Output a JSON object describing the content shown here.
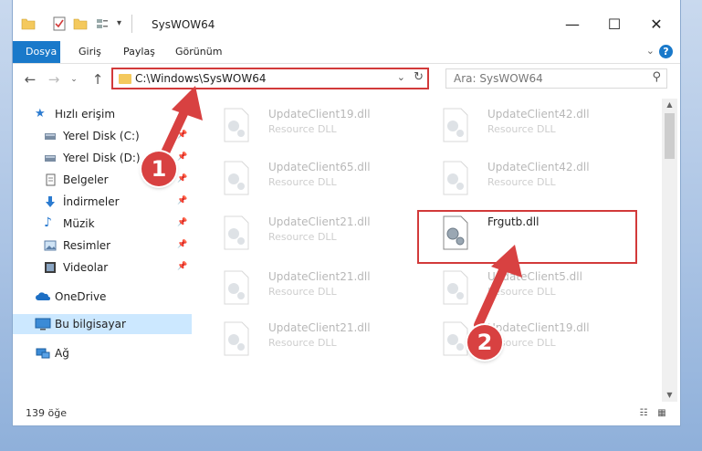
{
  "window": {
    "title": "SysWOW64",
    "controls": [
      "minimize-icon",
      "maximize-icon",
      "close-icon"
    ]
  },
  "ribbon": {
    "tabs": [
      {
        "label": "Dosya",
        "active": true
      },
      {
        "label": "Giriş"
      },
      {
        "label": "Paylaş"
      },
      {
        "label": "Görünüm"
      }
    ],
    "expand_icon": "chevron-down-icon",
    "help_label": "?"
  },
  "address": {
    "path": "C:\\Windows\\SysWOW64"
  },
  "search": {
    "placeholder": "Ara: SysWOW64"
  },
  "nav_pane": {
    "items": [
      {
        "label": "Hızlı erişim",
        "icon": "star-icon",
        "pinned": false
      },
      {
        "label": "Yerel Disk (C:)",
        "icon": "drive-icon",
        "pinned": true
      },
      {
        "label": "Yerel Disk (D:)",
        "icon": "drive-icon",
        "pinned": true
      },
      {
        "label": "Belgeler",
        "icon": "documents-icon",
        "pinned": true
      },
      {
        "label": "İndirmeler",
        "icon": "download-icon",
        "pinned": true
      },
      {
        "label": "Müzik",
        "icon": "music-icon",
        "pinned": true
      },
      {
        "label": "Resimler",
        "icon": "pictures-icon",
        "pinned": true
      },
      {
        "label": "Videolar",
        "icon": "video-icon",
        "pinned": true
      },
      {
        "label": "OneDrive",
        "icon": "cloud-icon",
        "pinned": false
      },
      {
        "label": "Bu bilgisayar",
        "icon": "computer-icon",
        "pinned": false,
        "selected": true
      },
      {
        "label": "Ağ",
        "icon": "network-icon",
        "pinned": false
      }
    ]
  },
  "files": [
    {
      "name": "UpdateClient19.dll",
      "type": "Resource DLL"
    },
    {
      "name": "UpdateClient42.dll",
      "type": "Resource DLL"
    },
    {
      "name": "UpdateClient65.dll",
      "type": "Resource DLL"
    },
    {
      "name": "UpdateClient42.dll",
      "type": "Resource DLL"
    },
    {
      "name": "UpdateClient21.dll",
      "type": "Resource DLL"
    },
    {
      "name": "Frgutb.dll",
      "type": "",
      "highlighted": true
    },
    {
      "name": "UpdateClient21.dll",
      "type": "Resource DLL"
    },
    {
      "name": "UpdateClient5.dll",
      "type": "Resource DLL"
    },
    {
      "name": "UpdateClient21.dll",
      "type": "Resource DLL"
    },
    {
      "name": "UpdateClient19.dll",
      "type": "Resource DLL"
    }
  ],
  "status": {
    "count": "139 öğe"
  },
  "annotations": {
    "step1": "1",
    "step2": "2",
    "color": "#d84141"
  },
  "colors": {
    "accent": "#1979ca",
    "highlight_border": "#d23a3a",
    "selection": "#cce8ff"
  }
}
